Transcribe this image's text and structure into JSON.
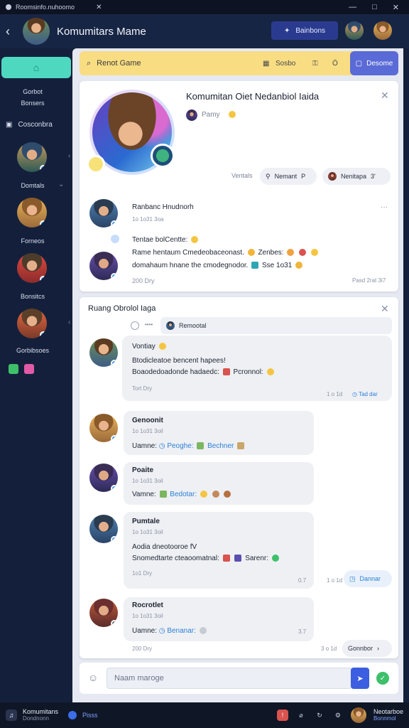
{
  "titlebar": {
    "tab_title": "Roomsinfo.nuhoomo",
    "close": "✕",
    "controls": [
      "—",
      "□",
      "✕"
    ]
  },
  "header": {
    "back_icon": "‹",
    "title": "Komumitars Mame",
    "action_label": "Bainbons",
    "action_icon": "✦"
  },
  "sidebar": {
    "home_icon": "⌂",
    "top_label_1": "Gorbot",
    "top_label_2": "Bonsers",
    "section_label": "Cosconbra",
    "section_icon": "▣",
    "members": [
      {
        "label": "Domtals"
      },
      {
        "label": "Forneos"
      },
      {
        "label": "Bonsitcs"
      },
      {
        "label": "Gorbibsoes"
      }
    ]
  },
  "search": {
    "placeholder": "Renot Game",
    "tool_1": "Sosbo",
    "tool_2": "Ö",
    "new_button": "Desome"
  },
  "profile": {
    "name": "Komumitan Oiet Nedanbiol Iaida",
    "status": "Pamy",
    "label": "Ventals",
    "btn1": "Nemant",
    "btn1_suffix": "P",
    "btn2": "Nenitapa",
    "btn2_suffix": "3'",
    "post_author": "Ranbanc Hnudnorh",
    "post_time": "1o 1o31 3oa",
    "post_quote": "Tentae bolCentte:",
    "post_line1": "Rame hentaum Cmedeobaceonast.",
    "post_line1_tag": "Zenbes:",
    "post_line2": "domahaum hnane the cmodegnodor.",
    "post_line2_tag": "Sse 1o31",
    "post_footer": "200 Dry",
    "post_footer_right": "Pasd 2rat 3i7",
    "more": "···"
  },
  "chat": {
    "title": "Ruang Obrolol Iaga",
    "filter_dots": "••••",
    "filter_label": "Remootal",
    "messages": [
      {
        "name": "Vontiay",
        "line1": "Btodicleatoe bencent hapees!",
        "line2": "Boaodedoadonde hadaedc:",
        "line2_tag": "Pcronnol:",
        "time": "Tort Dry",
        "meta": "1 o 1d",
        "action": "Tad dar"
      },
      {
        "name": "Genoonit",
        "time": "1o 1o31 3oil",
        "line1": "Uamne:",
        "line1_tag": "Peoghe:",
        "line1_tag2": "Bechner"
      },
      {
        "name": "Poaite",
        "time": "1o 1o31 3oil",
        "line1": "Vamne:",
        "line1_tag": "Bedotar:"
      },
      {
        "name": "Pumtale",
        "time": "1o 1o31 3oil",
        "line1": "Aodia dneotooroe fV",
        "line2": "Snomedtarte cteaoomatnal:",
        "line2_tag": "Sarenr:",
        "time2": "1o1 Dry",
        "meta": "0.7",
        "meta2": "1 o 1d",
        "action": "Dannar"
      },
      {
        "name": "Rocrotlet",
        "time": "1o 1o31 3oil",
        "line1": "Uamne:",
        "line1_tag": "Benanar:",
        "meta": "3.7",
        "footer": "200 Dry",
        "meta2": "3 o 1d",
        "action": "Gonnbor"
      }
    ]
  },
  "composer": {
    "placeholder": "Naam maroge",
    "send_icon": "➤",
    "ok_icon": "✓",
    "smile_icon": "☺"
  },
  "bottombar": {
    "app_name": "Komumitans",
    "app_sub": "Dondnonn",
    "item": "Pisss",
    "user_name": "Neotarboe",
    "user_sub": "Bonnmol"
  },
  "colors": {
    "accent": "#5a6ad6",
    "home": "#4fd8c0",
    "search_bg": "#f8dd83",
    "online": "#2f8cf0",
    "send": "#3c5ee0"
  }
}
